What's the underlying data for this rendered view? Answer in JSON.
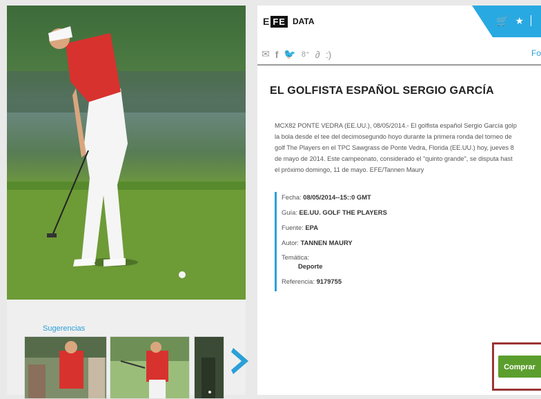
{
  "logo": {
    "prefix": "E",
    "box": "FE",
    "data": "DATA"
  },
  "topbar": {
    "cart_icon": "cart-remove-icon",
    "star_icon": "star-icon",
    "accent": "#29a9e1"
  },
  "social": {
    "icons": [
      "mail-icon",
      "facebook-icon",
      "twitter-icon",
      "google-plus-icon",
      "link-icon",
      "smiley-icon"
    ],
    "fo_link": "Fo"
  },
  "article": {
    "title": "EL GOLFISTA ESPAÑOL SERGIO GARCÍA",
    "caption_lines": [
      "MCX82 PONTE VEDRA (EE.UU.), 08/05/2014.- El golfista español Sergio García golp",
      "la bola desde el tee del decimosegundo hoyo durante la primera ronda del torneo de",
      "golf The Players en el TPC Sawgrass de Ponte Vedra, Florida (EE.UU.) hoy, jueves 8",
      "de mayo de 2014. Este campeonato, considerado el \"quinto grande\", se disputa hast",
      "el próximo domingo, 11 de mayo. EFE/Tannen Maury"
    ]
  },
  "meta": {
    "fecha_label": "Fecha:",
    "fecha_value": "08/05/2014--15::0 GMT",
    "guia_label": "Guía:",
    "guia_value": "EE.UU. GOLF THE PLAYERS",
    "fuente_label": "Fuente:",
    "fuente_value": "EPA",
    "autor_label": "Autor:",
    "autor_value": "TANNEN MAURY",
    "tematica_label": "Temática:",
    "tematica_value": "Deporte",
    "referencia_label": "Referencia:",
    "referencia_value": "9179755"
  },
  "suggestions": {
    "label": "Sugerencias"
  },
  "buy": {
    "label": "Comprar",
    "color": "#5c9e2e"
  }
}
